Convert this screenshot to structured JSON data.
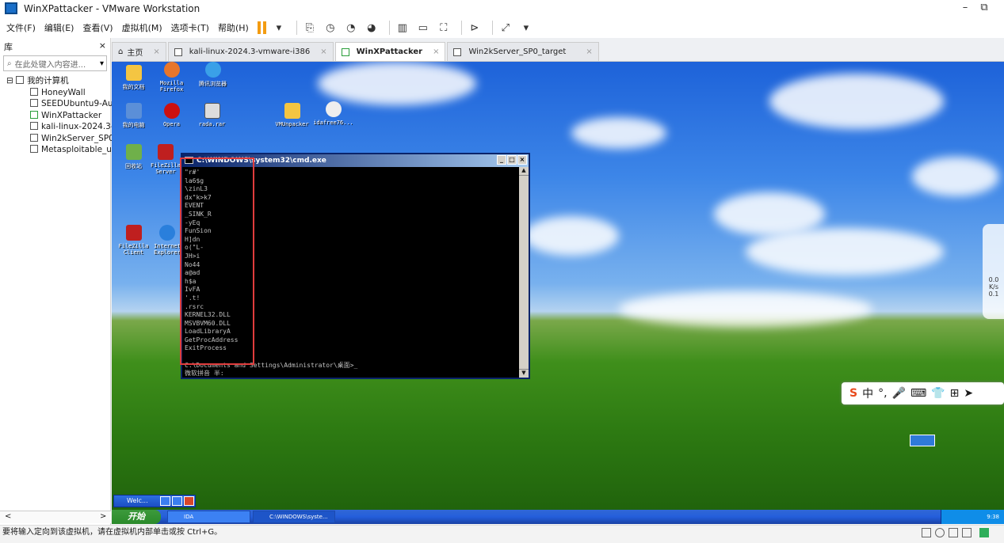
{
  "window": {
    "title": "WinXPattacker - VMware Workstation",
    "min": "–",
    "restore": "⧉"
  },
  "menu": [
    "文件(F)",
    "编辑(E)",
    "查看(V)",
    "虚拟机(M)",
    "选项卡(T)",
    "帮助(H)"
  ],
  "library": {
    "title": "库",
    "close": "×",
    "search_placeholder": "在此处键入内容进...",
    "root": "我的计算机",
    "vms": [
      "HoneyWall",
      "SEEDUbuntu9-Au",
      "WinXPattacker",
      "kali-linux-2024.3-",
      "Win2kServer_SP0",
      "Metasploitable_u"
    ],
    "scroll_left": "<",
    "scroll_right": ">"
  },
  "tabs": [
    {
      "label": "主页",
      "close": "×"
    },
    {
      "label": "kali-linux-2024.3-vmware-i386",
      "close": "×"
    },
    {
      "label": "WinXPattacker",
      "close": "×"
    },
    {
      "label": "Win2kServer_SP0_target",
      "close": "×"
    }
  ],
  "desktop_icons": [
    {
      "label": "我的文档",
      "color": "#f4c542"
    },
    {
      "label": "Mozilla Firefox",
      "color": "#e8762b"
    },
    {
      "label": "腾讯浏览器",
      "color": "#3aa0e8"
    },
    {
      "label": "我的电脑",
      "color": "#5b8fd8"
    },
    {
      "label": "Opera",
      "color": "#cc1010"
    },
    {
      "label": "rada.rar",
      "color": "#dddddd"
    },
    {
      "label": "VMUnpacker",
      "color": "#f4c542"
    },
    {
      "label": "idafree76...",
      "color": "#eeeeee"
    },
    {
      "label": "回收站",
      "color": "#6fb04a"
    },
    {
      "label": "FileZilla Server",
      "color": "#bf1f1f"
    },
    {
      "label": "FileZilla Client",
      "color": "#bf1f1f"
    },
    {
      "label": "Internet Explorer",
      "color": "#2a7fdc"
    }
  ],
  "cmd": {
    "title": "C:\\WINDOWS\\system32\\cmd.exe",
    "lines": [
      "\"r#'",
      "la6$g",
      "\\zinL3",
      "dx\"k>k7",
      "EVENT",
      "_SINK_R",
      "-yEq",
      "FunSion",
      "H]dn",
      "o(\"L-",
      "JH>i",
      "No44",
      "a@ad",
      "h$a",
      "IvFA",
      "'.t!",
      ".rsrc",
      "KERNEL32.DLL",
      "MSVBVM60.DLL",
      "LoadLibraryA",
      "GetProcAddress",
      "ExitProcess",
      "",
      "C:\\Documents and Settings\\Administrator\\桌面>_",
      "微软拼音 半:"
    ]
  },
  "xp_taskbar": {
    "start": "开始",
    "tasks": [
      "IDA",
      "C:\\WINDOWS\\syste..."
    ],
    "clock": "9:38",
    "welcome": "Welc..."
  },
  "ime": [
    "S",
    "中",
    "°,",
    "🎤",
    "⌨",
    "👕",
    "⊞",
    "➤"
  ],
  "side_gauge": {
    "up": "0.0",
    "down": "0.1",
    "unit": "K/s"
  },
  "status_text": "要将输入定向到该虚拟机，请在虚拟机内部单击或按 Ctrl+G。"
}
